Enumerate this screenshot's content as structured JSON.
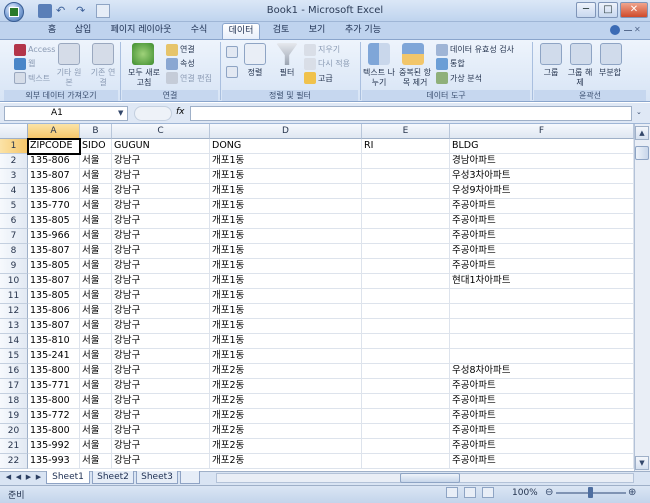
{
  "window": {
    "title": "Book1 - Microsoft Excel",
    "minimize": "─",
    "maximize": "□",
    "close": "✕"
  },
  "tabs": [
    "홈",
    "삽입",
    "페이지 레이아웃",
    "수식",
    "데이터",
    "검토",
    "보기",
    "추가 기능"
  ],
  "active_tab": "데이터",
  "ribbon": {
    "external": {
      "access": "Access",
      "web": "웹",
      "text": "텍스트",
      "other": "기타 원본",
      "existing": "기존 연결",
      "label": "외부 데이터 가져오기"
    },
    "connections": {
      "refresh_all": "모두 새로 고침",
      "connections": "연결",
      "properties": "속성",
      "edit_links": "연결 편집",
      "label": "연결"
    },
    "sort_filter": {
      "sort": "정렬",
      "filter": "필터",
      "clear": "지우기",
      "reapply": "다시 적용",
      "advanced": "고급",
      "label": "정렬 및 필터"
    },
    "data_tools": {
      "text_to_columns": "텍스트 나누기",
      "remove_duplicates": "중복된 항목 제거",
      "validation": "데이터 유효성 검사",
      "consolidate": "통합",
      "what_if": "가상 분석",
      "label": "데이터 도구"
    },
    "outline": {
      "group": "그룹",
      "ungroup": "그룹 해제",
      "subtotal": "부분합",
      "label": "윤곽선"
    }
  },
  "formula_bar": {
    "name_box": "A1",
    "fx": "fx",
    "value": ""
  },
  "columns": [
    "A",
    "B",
    "C",
    "D",
    "E",
    "F"
  ],
  "rows": [
    {
      "n": "1",
      "a": "ZIPCODE",
      "b": "SIDO",
      "c": "GUGUN",
      "d": "DONG",
      "e": "RI",
      "f": "BLDG"
    },
    {
      "n": "2",
      "a": "135-806",
      "b": "서울",
      "c": "강남구",
      "d": "개포1동",
      "e": "",
      "f": "경남아파트"
    },
    {
      "n": "3",
      "a": "135-807",
      "b": "서울",
      "c": "강남구",
      "d": "개포1동",
      "e": "",
      "f": "우성3차아파트"
    },
    {
      "n": "4",
      "a": "135-806",
      "b": "서울",
      "c": "강남구",
      "d": "개포1동",
      "e": "",
      "f": "우성9차아파트"
    },
    {
      "n": "5",
      "a": "135-770",
      "b": "서울",
      "c": "강남구",
      "d": "개포1동",
      "e": "",
      "f": "주공아파트"
    },
    {
      "n": "6",
      "a": "135-805",
      "b": "서울",
      "c": "강남구",
      "d": "개포1동",
      "e": "",
      "f": "주공아파트"
    },
    {
      "n": "7",
      "a": "135-966",
      "b": "서울",
      "c": "강남구",
      "d": "개포1동",
      "e": "",
      "f": "주공아파트"
    },
    {
      "n": "8",
      "a": "135-807",
      "b": "서울",
      "c": "강남구",
      "d": "개포1동",
      "e": "",
      "f": "주공아파트"
    },
    {
      "n": "9",
      "a": "135-805",
      "b": "서울",
      "c": "강남구",
      "d": "개포1동",
      "e": "",
      "f": "주공아파트"
    },
    {
      "n": "10",
      "a": "135-807",
      "b": "서울",
      "c": "강남구",
      "d": "개포1동",
      "e": "",
      "f": "현대1차아파트"
    },
    {
      "n": "11",
      "a": "135-805",
      "b": "서울",
      "c": "강남구",
      "d": "개포1동",
      "e": "",
      "f": ""
    },
    {
      "n": "12",
      "a": "135-806",
      "b": "서울",
      "c": "강남구",
      "d": "개포1동",
      "e": "",
      "f": ""
    },
    {
      "n": "13",
      "a": "135-807",
      "b": "서울",
      "c": "강남구",
      "d": "개포1동",
      "e": "",
      "f": ""
    },
    {
      "n": "14",
      "a": "135-810",
      "b": "서울",
      "c": "강남구",
      "d": "개포1동",
      "e": "",
      "f": ""
    },
    {
      "n": "15",
      "a": "135-241",
      "b": "서울",
      "c": "강남구",
      "d": "개포1동",
      "e": "",
      "f": ""
    },
    {
      "n": "16",
      "a": "135-800",
      "b": "서울",
      "c": "강남구",
      "d": "개포2동",
      "e": "",
      "f": "우성8차아파트"
    },
    {
      "n": "17",
      "a": "135-771",
      "b": "서울",
      "c": "강남구",
      "d": "개포2동",
      "e": "",
      "f": "주공아파트"
    },
    {
      "n": "18",
      "a": "135-800",
      "b": "서울",
      "c": "강남구",
      "d": "개포2동",
      "e": "",
      "f": "주공아파트"
    },
    {
      "n": "19",
      "a": "135-772",
      "b": "서울",
      "c": "강남구",
      "d": "개포2동",
      "e": "",
      "f": "주공아파트"
    },
    {
      "n": "20",
      "a": "135-800",
      "b": "서울",
      "c": "강남구",
      "d": "개포2동",
      "e": "",
      "f": "주공아파트"
    },
    {
      "n": "21",
      "a": "135-992",
      "b": "서울",
      "c": "강남구",
      "d": "개포2동",
      "e": "",
      "f": "주공아파트"
    },
    {
      "n": "22",
      "a": "135-993",
      "b": "서울",
      "c": "강남구",
      "d": "개포2동",
      "e": "",
      "f": "주공아파트"
    }
  ],
  "sheets": [
    "Sheet1",
    "Sheet2",
    "Sheet3"
  ],
  "active_sheet": "Sheet1",
  "status": {
    "ready": "준비",
    "zoom": "100%"
  },
  "colors": {
    "accent": "#bfd3ee",
    "selected_header": "#f5c66a",
    "grid_line": "#dde3ec"
  }
}
